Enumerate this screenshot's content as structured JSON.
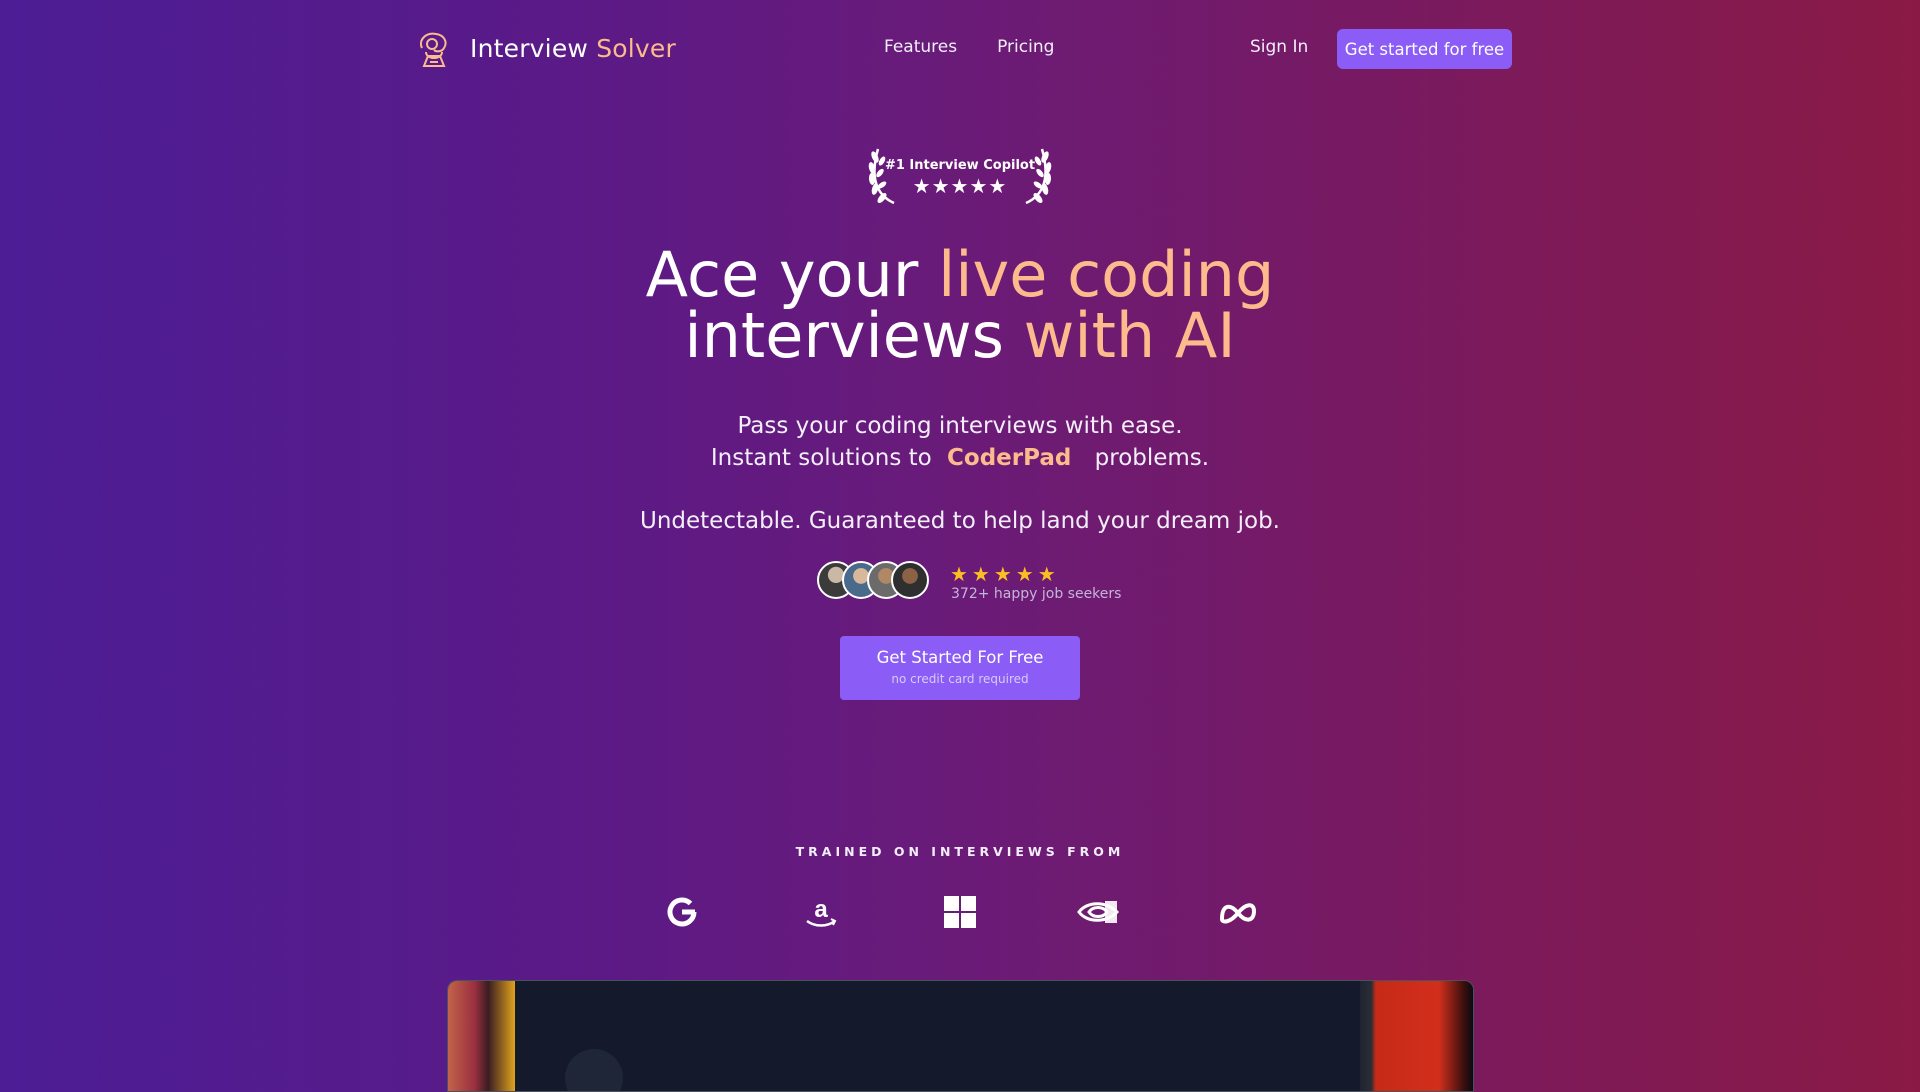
{
  "header": {
    "brand_part1": "Interview",
    "brand_part2": "Solver",
    "nav": [
      "Features",
      "Pricing"
    ],
    "sign_in": "Sign In",
    "cta": "Get started for free"
  },
  "badge": {
    "label": "#1 Interview Copilot",
    "stars": "★★★★★"
  },
  "hero": {
    "title_line1_a": "Ace your",
    "title_line1_b": "live coding",
    "title_line2_a": "interviews",
    "title_line2_b": "with AI",
    "subtitle_line1": "Pass your coding interviews with ease.",
    "subtitle_line2_a": "Instant solutions to",
    "subtitle_line2_brand": "CoderPad",
    "subtitle_line2_b": "problems.",
    "tagline": "Undetectable. Guaranteed to help land your dream job."
  },
  "social_proof": {
    "stars": "★★★★★",
    "text": "372+ happy job seekers",
    "avatar_count": 4
  },
  "main_cta": {
    "label": "Get Started For Free",
    "sublabel": "no credit card required"
  },
  "trained": {
    "heading": "TRAINED ON INTERVIEWS FROM",
    "logos": [
      "google-icon",
      "amazon-icon",
      "microsoft-icon",
      "nvidia-icon",
      "meta-icon"
    ]
  },
  "colors": {
    "accent": "#8b5cf6",
    "peach": "#fdba8c",
    "star": "#fbbf24"
  }
}
